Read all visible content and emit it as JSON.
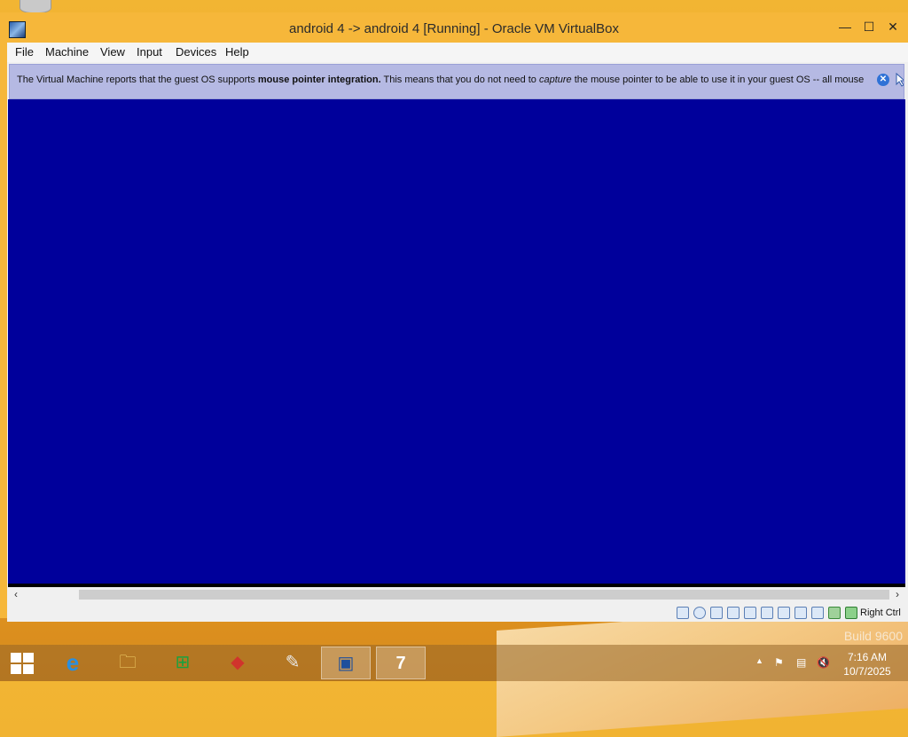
{
  "window": {
    "title": "android 4 -> android 4 [Running] - Oracle VM VirtualBox",
    "minimize_glyph": "—",
    "maximize_glyph": "☐",
    "close_glyph": "✕"
  },
  "menu": {
    "items": [
      "File",
      "Machine",
      "View",
      "Input",
      "Devices",
      "Help"
    ]
  },
  "notice": {
    "text_before": "The Virtual Machine reports that the guest OS supports ",
    "bold": "mouse pointer integration.",
    "text_middle": " This means that you do not need to ",
    "italic": "capture",
    "text_after": " the mouse pointer to be able to use it in your guest OS -- all mouse"
  },
  "vm": {
    "background": "#00009b"
  },
  "statusbar": {
    "icons": [
      "hard-disk-icon",
      "optical-disk-icon",
      "audio-icon",
      "network-icon",
      "usb-icon",
      "shared-folder-icon",
      "display-icon",
      "video-capture-icon",
      "mouse-integration-icon",
      "virtualization-icon",
      "cpu-icon",
      "keyboard-icon"
    ],
    "host_key": "Right Ctrl"
  },
  "desktop": {
    "build_text": "Build 9600"
  },
  "taskbar": {
    "apps": [
      {
        "name": "internet-explorer-icon",
        "glyph": "e",
        "color": "#2a8fe0"
      },
      {
        "name": "file-explorer-icon",
        "glyph": "🗀",
        "color": "#f4d36b"
      },
      {
        "name": "store-icon",
        "glyph": "⊞",
        "color": "#1aa13f"
      },
      {
        "name": "foxit-icon",
        "glyph": "◆",
        "color": "#d0342c"
      },
      {
        "name": "paint-app-icon",
        "glyph": "✎",
        "color": "#e8e8e8"
      },
      {
        "name": "virtualbox-manager-icon",
        "glyph": "▣",
        "color": "#1e4f9c"
      },
      {
        "name": "virtualbox-vm-icon",
        "glyph": "7",
        "color": "#ffffff"
      }
    ],
    "clock_time": "7:16 AM",
    "clock_date": "10/7/2025"
  }
}
